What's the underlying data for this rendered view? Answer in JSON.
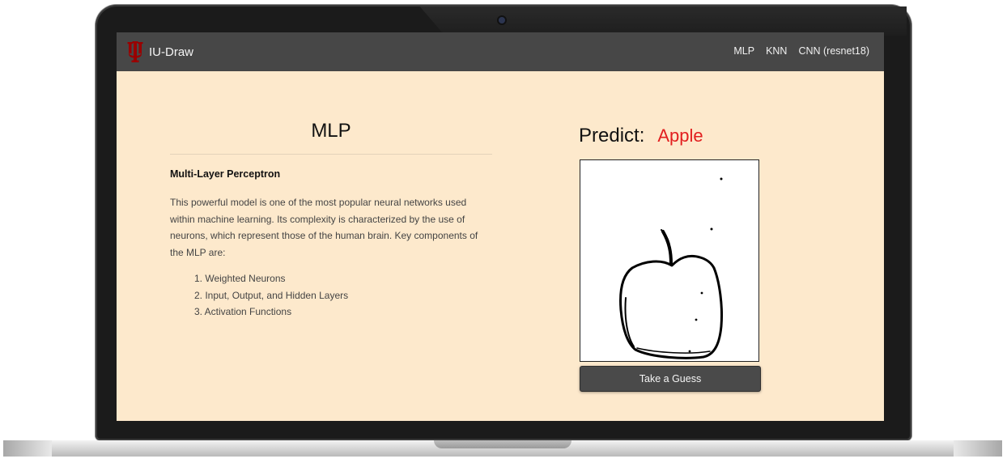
{
  "navbar": {
    "brand": "IU-Draw",
    "logo_icon": "iu-trident-icon",
    "logo_color": "#990000",
    "links": [
      "MLP",
      "KNN",
      "CNN (resnet18)"
    ]
  },
  "main": {
    "model_title": "MLP",
    "subtitle": "Multi-Layer Perceptron",
    "description": "This powerful model is one of the most popular neural networks used within machine learning. Its complexity is characterized by the use of neurons, which represent those of the human brain. Key components of the MLP are:",
    "components": [
      "1. Weighted Neurons",
      "2. Input, Output, and Hidden Layers",
      "3. Activation Functions"
    ]
  },
  "prediction": {
    "label": "Predict:",
    "value": "Apple",
    "value_color": "#e21f1f"
  },
  "drawing_canvas": {
    "content": "apple-sketch"
  },
  "actions": {
    "guess_label": "Take a Guess"
  },
  "colors": {
    "page_background": "#fde9cc",
    "navbar_background": "#474747",
    "button_background": "#4a4a4a"
  }
}
